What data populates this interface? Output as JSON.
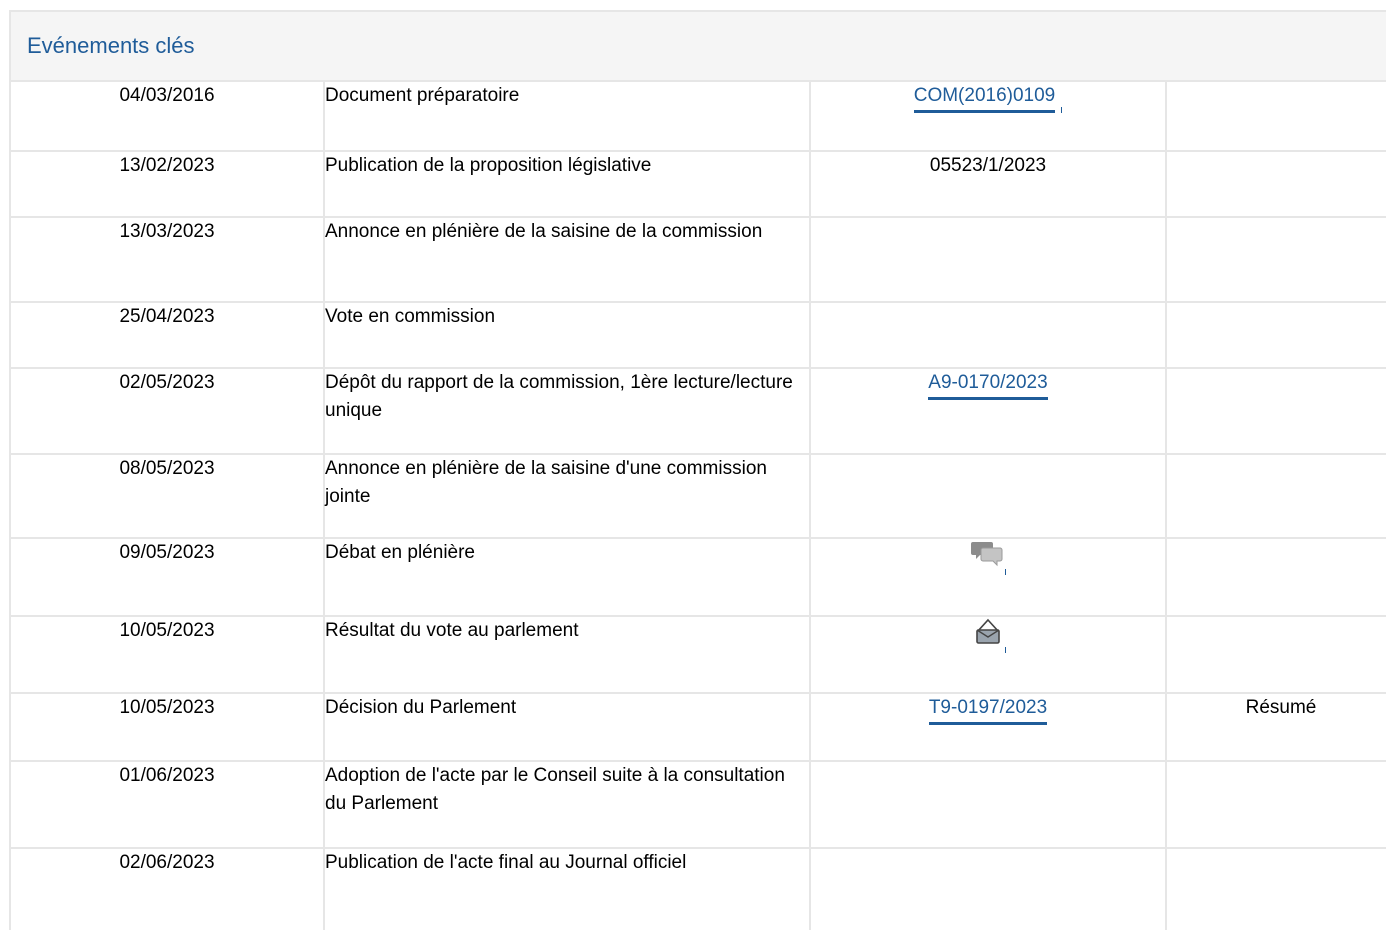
{
  "panel": {
    "title": "Evénements clés"
  },
  "events": [
    {
      "date": "04/03/2016",
      "event": "Document préparatoire",
      "ref": "COM(2016)0109",
      "ref_type": "link",
      "summary": ""
    },
    {
      "date": "13/02/2023",
      "event": "Publication de la proposition législative",
      "ref": "05523/1/2023",
      "ref_type": "text",
      "summary": ""
    },
    {
      "date": "13/03/2023",
      "event": "Annonce en plénière de la saisine de la commission",
      "ref": "",
      "ref_type": "none",
      "summary": ""
    },
    {
      "date": "25/04/2023",
      "event": "Vote en commission",
      "ref": "",
      "ref_type": "none",
      "summary": ""
    },
    {
      "date": "02/05/2023",
      "event": "Dépôt du rapport de la commission, 1ère lecture/lecture unique",
      "ref": "A9-0170/2023",
      "ref_type": "link",
      "summary": ""
    },
    {
      "date": "08/05/2023",
      "event": "Annonce en plénière de la saisine d'une commission jointe",
      "ref": "",
      "ref_type": "none",
      "summary": ""
    },
    {
      "date": "09/05/2023",
      "event": "Débat en plénière",
      "ref": "",
      "ref_type": "icon",
      "icon": "debate-speech-bubbles-icon",
      "summary": ""
    },
    {
      "date": "10/05/2023",
      "event": "Résultat du vote au parlement",
      "ref": "",
      "ref_type": "icon",
      "icon": "vote-ballot-box-icon",
      "summary": ""
    },
    {
      "date": "10/05/2023",
      "event": "Décision du Parlement",
      "ref": "T9-0197/2023",
      "ref_type": "link",
      "summary": "Résumé"
    },
    {
      "date": "01/06/2023",
      "event": "Adoption de l'acte par le Conseil suite à la consultation du Parlement",
      "ref": "",
      "ref_type": "none",
      "summary": ""
    },
    {
      "date": "02/06/2023",
      "event": "Publication de l'acte final au Journal officiel",
      "ref": "",
      "ref_type": "none",
      "summary": ""
    }
  ],
  "colors": {
    "link": "#1f5c99",
    "border": "#e6e6e6",
    "header_bg": "#f5f5f5"
  }
}
